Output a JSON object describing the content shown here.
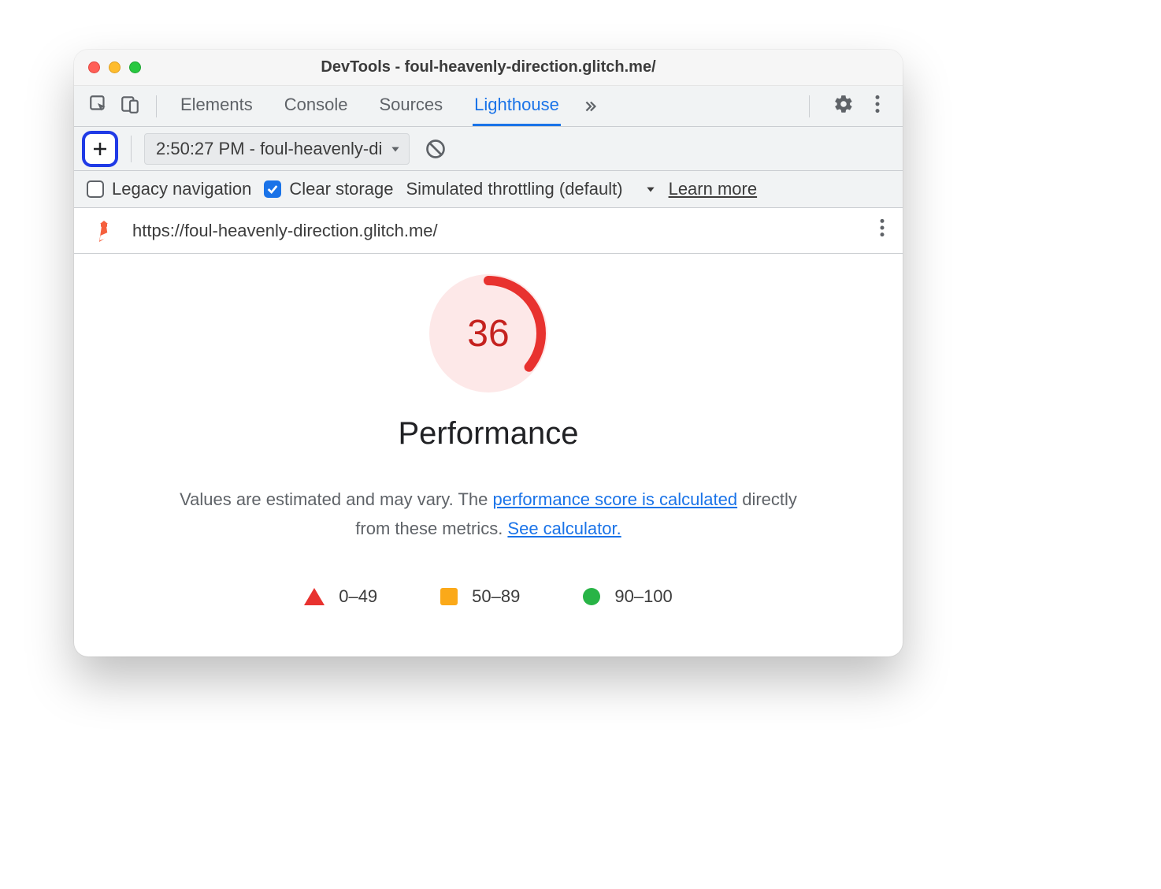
{
  "window": {
    "title": "DevTools - foul-heavenly-direction.glitch.me/"
  },
  "tabbar": {
    "tabs": [
      "Elements",
      "Console",
      "Sources",
      "Lighthouse"
    ],
    "active_index": 3
  },
  "lighthouse_toolbar": {
    "report_selector": "2:50:27 PM - foul-heavenly-di",
    "legacy_navigation_label": "Legacy navigation",
    "legacy_navigation_checked": false,
    "clear_storage_label": "Clear storage",
    "clear_storage_checked": true,
    "throttling_label": "Simulated throttling (default)",
    "learn_more": "Learn more"
  },
  "report": {
    "url": "https://foul-heavenly-direction.glitch.me/",
    "score": 36,
    "category": "Performance",
    "desc_prefix": "Values are estimated and may vary. The ",
    "desc_link1": "performance score is calculated",
    "desc_mid": " directly from these metrics. ",
    "desc_link2": "See calculator.",
    "legend": {
      "low": "0–49",
      "mid": "50–89",
      "high": "90–100"
    }
  },
  "colors": {
    "red": "#e8322f",
    "orange": "#fba919",
    "green": "#28b446",
    "link": "#1a73e8"
  },
  "chart_data": {
    "type": "pie",
    "title": "Performance",
    "categories": [
      "Performance score"
    ],
    "values": [
      36
    ],
    "ylim": [
      0,
      100
    ]
  }
}
